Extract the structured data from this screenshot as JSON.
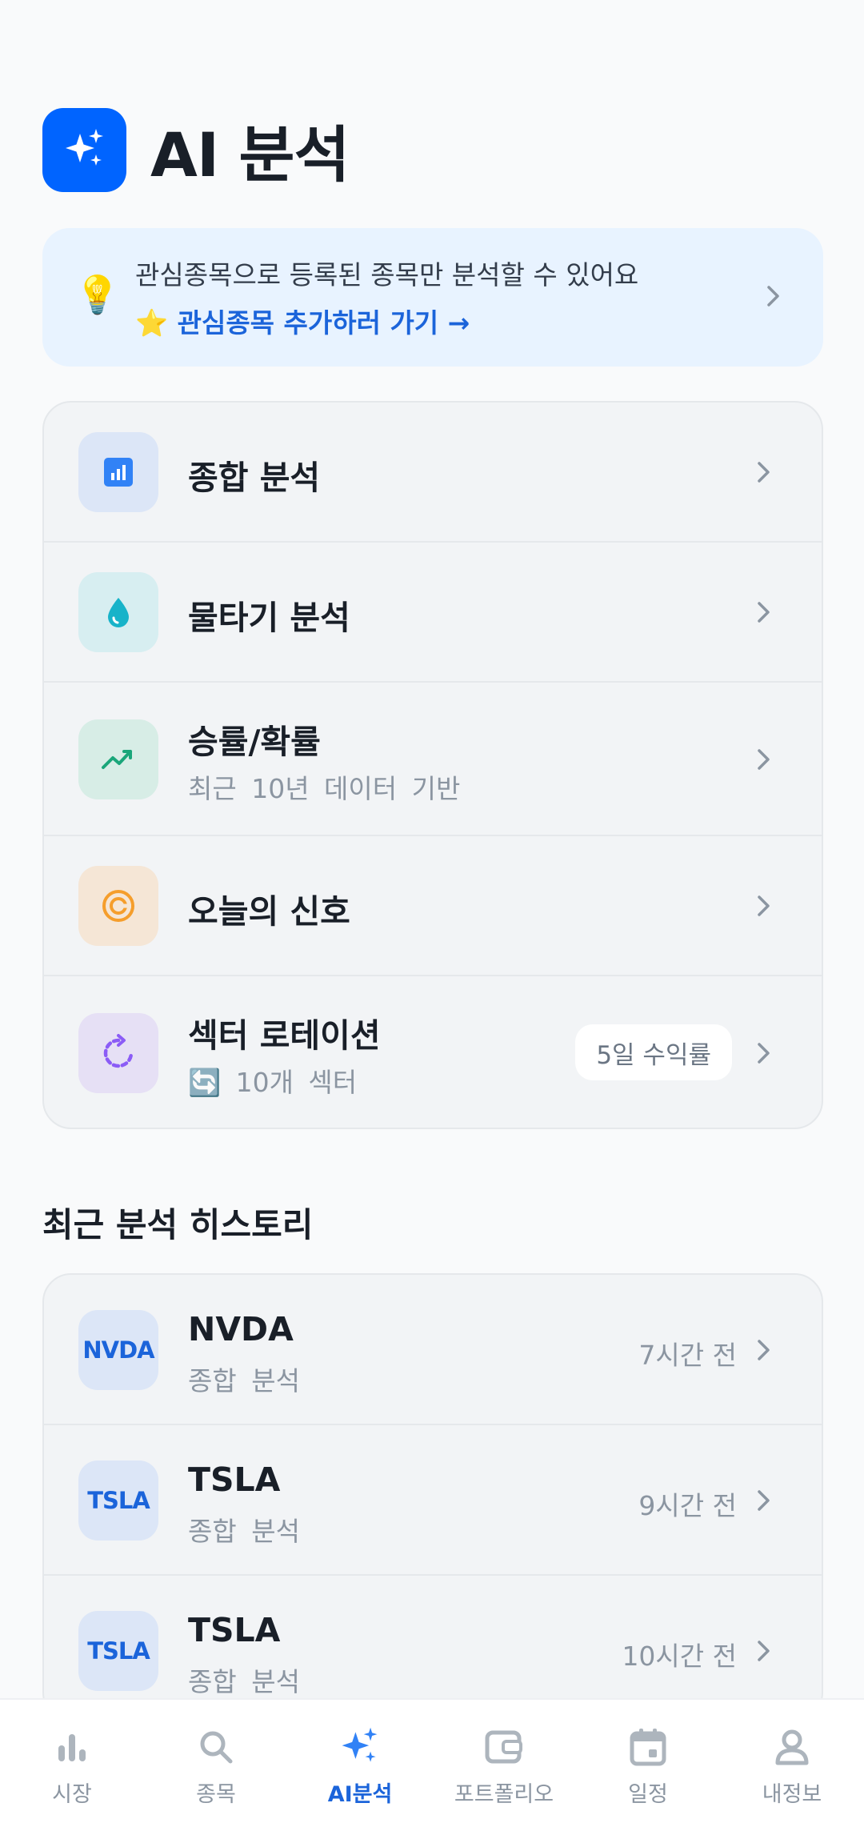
{
  "header": {
    "title": "AI 분석",
    "icon": "sparkles-icon",
    "accent": "#0064ff"
  },
  "notice": {
    "icon": "lightbulb-icon",
    "message": "관심종목으로 등록된 종목만 분석할 수 있어요",
    "link_star": "⭐",
    "link_label": "관심종목 추가하러 가기 →"
  },
  "menu": [
    {
      "id": "overall",
      "title": "종합 분석",
      "icon": "bar-chart-icon"
    },
    {
      "id": "averaging",
      "title": "물타기 분석",
      "icon": "water-drop-icon"
    },
    {
      "id": "winrate",
      "title": "승률/확률",
      "subtitle": "최근 10년 데이터 기반",
      "icon": "trend-up-icon"
    },
    {
      "id": "signal",
      "title": "오늘의 신호",
      "icon": "target-icon"
    },
    {
      "id": "sector",
      "title": "섹터 로테이션",
      "subtitle_emoji": "🔄",
      "subtitle": "10개 섹터",
      "badge": "5일 수익률",
      "icon": "rotate-icon"
    }
  ],
  "history": {
    "title": "최근 분석 히스토리",
    "items": [
      {
        "ticker": "NVDA",
        "type": "종합 분석",
        "time": "7시간 전"
      },
      {
        "ticker": "TSLA",
        "type": "종합 분석",
        "time": "9시간 전"
      },
      {
        "ticker": "TSLA",
        "type": "종합 분석",
        "time": "10시간 전"
      }
    ]
  },
  "tabs": [
    {
      "label": "시장",
      "icon": "bar-chart-icon",
      "active": false
    },
    {
      "label": "종목",
      "icon": "search-icon",
      "active": false
    },
    {
      "label": "AI분석",
      "icon": "sparkles-icon",
      "active": true
    },
    {
      "label": "포트폴리오",
      "icon": "wallet-icon",
      "active": false
    },
    {
      "label": "일정",
      "icon": "calendar-icon",
      "active": false
    },
    {
      "label": "내정보",
      "icon": "person-icon",
      "active": false
    }
  ]
}
